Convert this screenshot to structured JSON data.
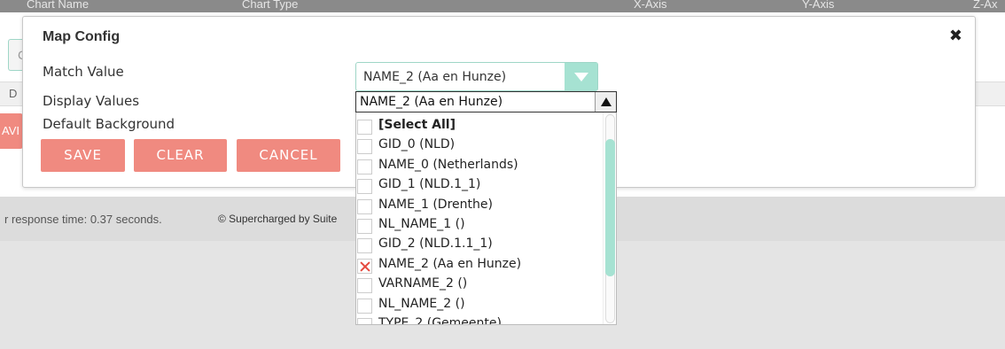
{
  "background": {
    "header_cols": [
      "Chart Name",
      "Chart Type",
      "X-Axis",
      "Y-Axis",
      "Z-Ax"
    ],
    "left_box_letter": "C",
    "row_letter": "D",
    "save_fragment": "AVI",
    "footer_response": "r response time: 0.37 seconds.",
    "footer_powered": "© Supercharged by Suite"
  },
  "modal": {
    "title": "Map Config",
    "close_glyph": "✖",
    "labels": {
      "match_value": "Match Value",
      "display_values": "Display Values",
      "default_background": "Default Background"
    },
    "match_value_selected": "NAME_2 (Aa en Hunze)",
    "buttons": {
      "save": "SAVE",
      "clear": "CLEAR",
      "cancel": "CANCEL"
    }
  },
  "display_values": {
    "selected": "NAME_2 (Aa en Hunze)",
    "options": [
      {
        "label": "[Select All]",
        "checked": false,
        "bold": true
      },
      {
        "label": "GID_0 (NLD)",
        "checked": false
      },
      {
        "label": "NAME_0 (Netherlands)",
        "checked": false
      },
      {
        "label": "GID_1 (NLD.1_1)",
        "checked": false
      },
      {
        "label": "NAME_1 (Drenthe)",
        "checked": false
      },
      {
        "label": "NL_NAME_1 ()",
        "checked": false
      },
      {
        "label": "GID_2 (NLD.1.1_1)",
        "checked": false
      },
      {
        "label": "NAME_2 (Aa en Hunze)",
        "checked": true
      },
      {
        "label": "VARNAME_2 ()",
        "checked": false
      },
      {
        "label": "NL_NAME_2 ()",
        "checked": false
      },
      {
        "label": "TYPE_2 (Gemeente)",
        "checked": false
      }
    ]
  },
  "colors": {
    "accent_teal": "#a6e2d2",
    "button_salmon": "#f08a80",
    "check_red": "#e5483d"
  }
}
